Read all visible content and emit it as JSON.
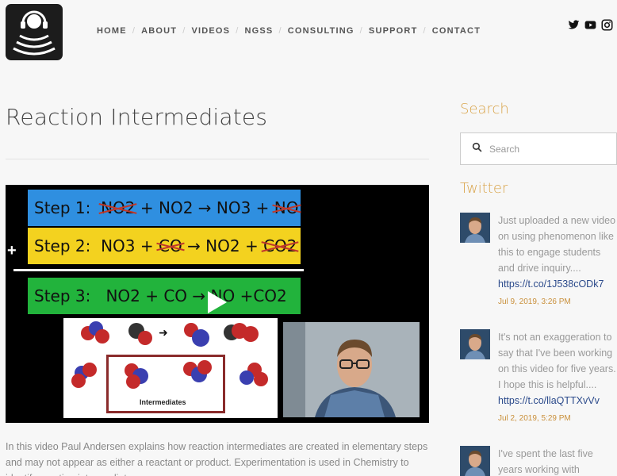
{
  "nav": {
    "items": [
      {
        "label": "HOME"
      },
      {
        "label": "ABOUT"
      },
      {
        "label": "VIDEOS"
      },
      {
        "label": "NGSS"
      },
      {
        "label": "CONSULTING"
      },
      {
        "label": "SUPPORT"
      },
      {
        "label": "CONTACT"
      }
    ]
  },
  "social": [
    "twitter-icon",
    "youtube-icon",
    "instagram-icon"
  ],
  "page": {
    "title": "Reaction Intermediates",
    "description": "In this video Paul Andersen explains how reaction intermediates are created in elementary steps and may not appear as either a reactant or product. Experimentation is used in Chemistry to identify reaction intermediates."
  },
  "video": {
    "step1": {
      "label": "Step 1:",
      "a": "NO2",
      "b": "+ NO2 → NO3 +",
      "c": "NO"
    },
    "step2": {
      "label": "Step 2:",
      "a": "NO3 +",
      "b": "CO",
      "c": "→ NO2 +",
      "d": "CO2"
    },
    "step3": {
      "label": "Step 3:",
      "eq": "NO2 + CO → NO +CO2"
    },
    "plus": "+",
    "intermediates_label": "Intermediates"
  },
  "sidebar": {
    "search_heading": "Search",
    "search_placeholder": "Search",
    "twitter_heading": "Twitter",
    "tweets": [
      {
        "text": "Just uploaded a new video on using phenomenon like this to engage students and drive inquiry....",
        "link": "https://t.co/1J538cODk7",
        "date": "Jul 9, 2019, 3:26 PM"
      },
      {
        "text": "It's not an exaggeration to say that I've been working on this video for five years. I hope this is helpful....",
        "link": "https://t.co/llaQTTXvVv",
        "date": "Jul 2, 2019, 5:29 PM"
      },
      {
        "text": "I've spent the last five years working with",
        "link": "",
        "date": ""
      }
    ]
  },
  "colors": {
    "accent": "#d9a44a",
    "link": "#2b4a8b",
    "step1": "#2f8fe0",
    "step2": "#f3d21f",
    "step3": "#22b33c"
  }
}
